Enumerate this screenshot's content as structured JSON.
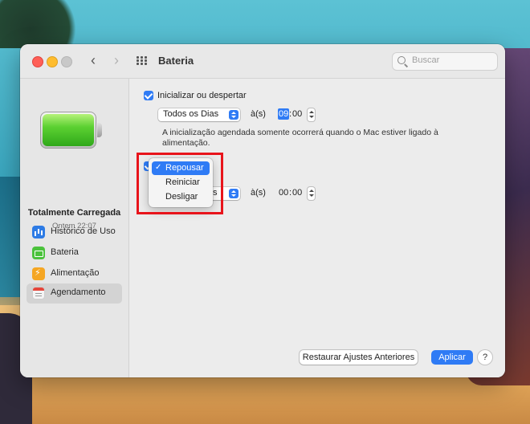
{
  "window": {
    "title": "Bateria",
    "search_placeholder": "Buscar"
  },
  "sidebar": {
    "battery_status": "Totalmente Carregada",
    "battery_time": "Ontem 22:07",
    "items": [
      {
        "label": "Histórico de Uso",
        "icon": "chart-icon"
      },
      {
        "label": "Bateria",
        "icon": "battery-icon"
      },
      {
        "label": "Alimentação",
        "icon": "power-bolt-icon"
      },
      {
        "label": "Agendamento",
        "icon": "calendar-icon",
        "selected": true
      }
    ]
  },
  "schedule": {
    "startup": {
      "label": "Inicializar ou despertar",
      "checked": true,
      "day_option": "Todos os Dias",
      "at_label": "à(s)",
      "hour": "09",
      "separator": ":",
      "minute": "00"
    },
    "note": "A inicialização agendada somente ocorrerá quando o Mac estiver ligado à alimentação.",
    "second": {
      "checked": true,
      "day_option_partial": "s",
      "at_label": "à(s)",
      "hour": "00",
      "separator": ":",
      "minute": "00"
    },
    "action_menu": {
      "selected_index": 0,
      "items": [
        "Repousar",
        "Reiniciar",
        "Desligar"
      ],
      "checkmark": "✓"
    }
  },
  "footer": {
    "reset_label": "Restaurar Ajustes Anteriores",
    "apply_label": "Aplicar",
    "help_label": "?"
  },
  "colors": {
    "accent": "#2f7bf5",
    "highlight_box": "#e8141b"
  }
}
